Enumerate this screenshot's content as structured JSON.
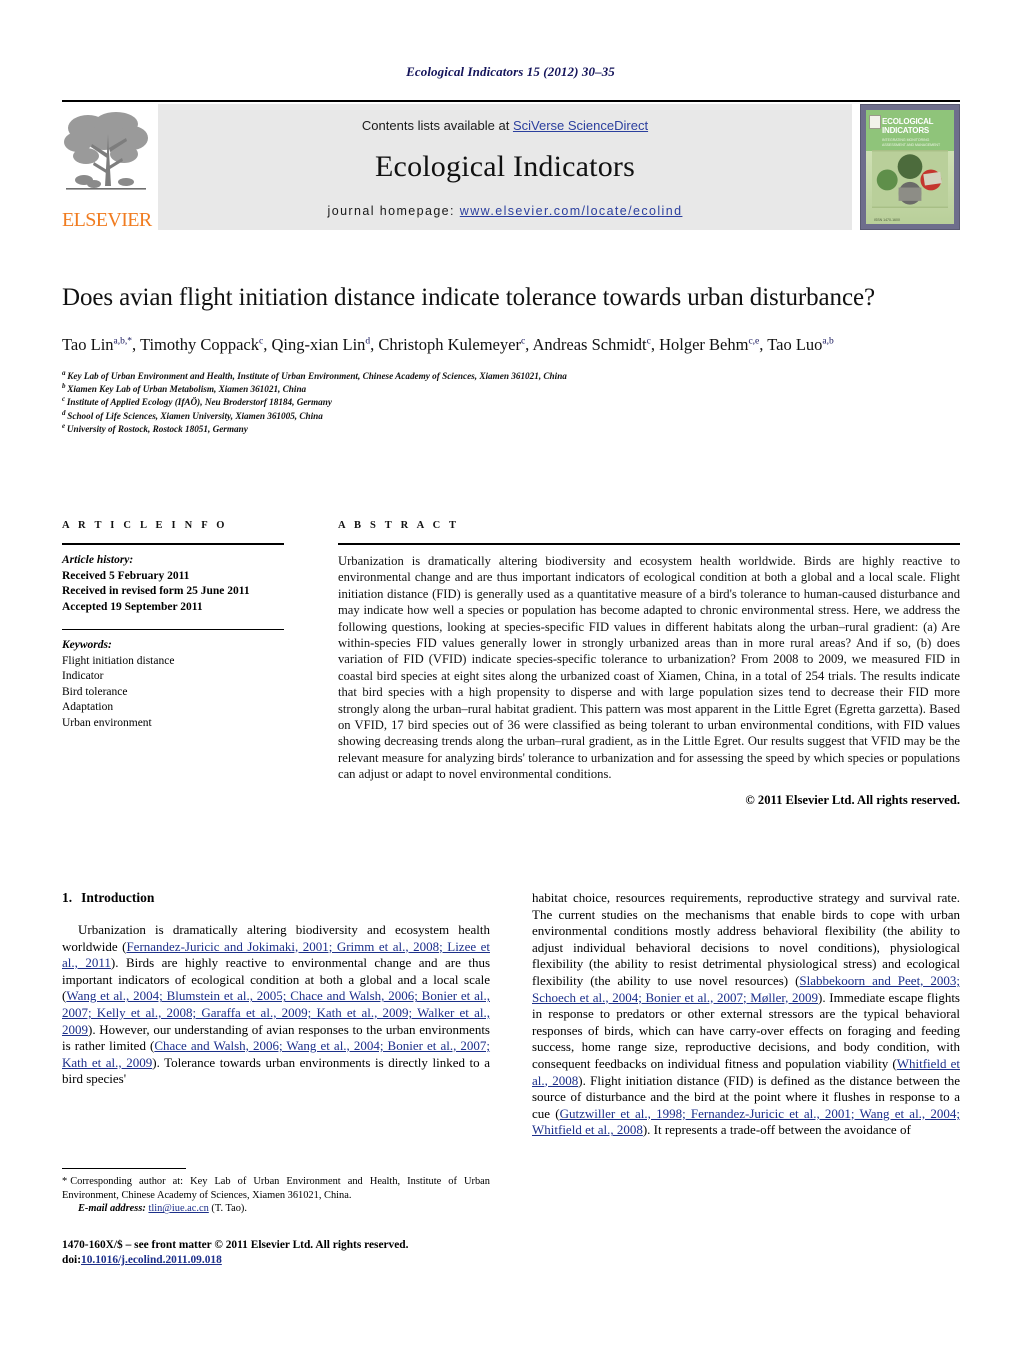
{
  "running_head": "Ecological Indicators 15 (2012) 30–35",
  "masthead": {
    "publisher_name": "ELSEVIER",
    "contents_prefix": "Contents lists available at ",
    "contents_link": "SciVerse ScienceDirect",
    "journal_name": "Ecological Indicators",
    "homepage_prefix": "journal homepage: ",
    "homepage_url": "www.elsevier.com/locate/ecolind",
    "cover": {
      "title_line1": "ECOLOGICAL",
      "title_line2": "INDICATORS",
      "subtitle": "INTEGRATING MONITORING ASSESSMENT AND MANAGEMENT",
      "footer": "ISSN 1470-160X"
    }
  },
  "article": {
    "title": "Does avian flight initiation distance indicate tolerance towards urban disturbance?",
    "authors": [
      {
        "name": "Tao Lin",
        "sup": "a,b,*",
        "sep": ", "
      },
      {
        "name": "Timothy Coppack",
        "sup": "c",
        "sep": ", "
      },
      {
        "name": "Qing-xian Lin",
        "sup": "d",
        "sep": ", "
      },
      {
        "name": "Christoph Kulemeyer",
        "sup": "c",
        "sep": ", "
      },
      {
        "name": "Andreas Schmidt",
        "sup": "c",
        "sep": ", "
      },
      {
        "name": "Holger Behm",
        "sup": "c,e",
        "sep": ", "
      },
      {
        "name": "Tao Luo",
        "sup": "a,b",
        "sep": ""
      }
    ],
    "affiliations": [
      {
        "sup": "a",
        "text": "Key Lab of Urban Environment and Health, Institute of Urban Environment, Chinese Academy of Sciences, Xiamen 361021, China"
      },
      {
        "sup": "b",
        "text": "Xiamen Key Lab of Urban Metabolism, Xiamen 361021, China"
      },
      {
        "sup": "c",
        "text": "Institute of Applied Ecology (IfAÖ), Neu Broderstorf 18184, Germany"
      },
      {
        "sup": "d",
        "text": "School of Life Sciences, Xiamen University, Xiamen 361005, China"
      },
      {
        "sup": "e",
        "text": "University of Rostock, Rostock 18051, Germany"
      }
    ]
  },
  "article_info": {
    "heading": "A R T I C L E   I N F O",
    "history_label": "Article history:",
    "history": [
      "Received 5 February 2011",
      "Received in revised form 25 June 2011",
      "Accepted 19 September 2011"
    ],
    "keywords_label": "Keywords:",
    "keywords": [
      "Flight initiation distance",
      "Indicator",
      "Bird tolerance",
      "Adaptation",
      "Urban environment"
    ]
  },
  "abstract": {
    "heading": "A B S T R A C T",
    "text": "Urbanization is dramatically altering biodiversity and ecosystem health worldwide. Birds are highly reactive to environmental change and are thus important indicators of ecological condition at both a global and a local scale. Flight initiation distance (FID) is generally used as a quantitative measure of a bird's tolerance to human-caused disturbance and may indicate how well a species or population has become adapted to chronic environmental stress. Here, we address the following questions, looking at species-specific FID values in different habitats along the urban–rural gradient: (a) Are within-species FID values generally lower in strongly urbanized areas than in more rural areas? And if so, (b) does variation of FID (VFID) indicate species-specific tolerance to urbanization? From 2008 to 2009, we measured FID in coastal bird species at eight sites along the urbanized coast of Xiamen, China, in a total of 254 trials. The results indicate that bird species with a high propensity to disperse and with large population sizes tend to decrease their FID more strongly along the urban–rural habitat gradient. This pattern was most apparent in the Little Egret (Egretta garzetta). Based on VFID, 17 bird species out of 36 were classified as being tolerant to urban environmental conditions, with FID values showing decreasing trends along the urban–rural gradient, as in the Little Egret. Our results suggest that VFID may be the relevant measure for analyzing birds' tolerance to urbanization and for assessing the speed by which species or populations can adjust or adapt to novel environmental conditions.",
    "copyright": "© 2011 Elsevier Ltd. All rights reserved."
  },
  "body": {
    "section_number": "1.",
    "section_title": "Introduction",
    "left_paragraph_parts": [
      {
        "t": "Urbanization is dramatically altering biodiversity and ecosystem health worldwide (",
        "c": false
      },
      {
        "t": "Fernandez-Juricic and Jokimaki, 2001; Grimm et al., 2008; Lizee et al., 2011",
        "c": true
      },
      {
        "t": "). Birds are highly reactive to environmental change and are thus important indicators of ecological condition at both a global and a local scale (",
        "c": false
      },
      {
        "t": "Wang et al., 2004; Blumstein et al., 2005; Chace and Walsh, 2006; Bonier et al., 2007; Kelly et al., 2008; Garaffa et al., 2009; Kath et al., 2009; Walker et al., 2009",
        "c": true
      },
      {
        "t": "). However, our understanding of avian responses to the urban environments is rather limited (",
        "c": false
      },
      {
        "t": "Chace and Walsh, 2006; Wang et al., 2004; Bonier et al., 2007; Kath et al., 2009",
        "c": true
      },
      {
        "t": "). Tolerance towards urban environments is directly linked to a bird species'",
        "c": false
      }
    ],
    "right_paragraph_parts": [
      {
        "t": "habitat choice, resources requirements, reproductive strategy and survival rate. The current studies on the mechanisms that enable birds to cope with urban environmental conditions mostly address behavioral flexibility (the ability to adjust individual behavioral decisions to novel conditions), physiological flexibility (the ability to resist detrimental physiological stress) and ecological flexibility (the ability to use novel resources) (",
        "c": false
      },
      {
        "t": "Slabbekoorn and Peet, 2003; Schoech et al., 2004; Bonier et al., 2007; Møller, 2009",
        "c": true
      },
      {
        "t": "). Immediate escape flights in response to predators or other external stressors are the typical behavioral responses of birds, which can have carry-over effects on foraging and feeding success, home range size, reproductive decisions, and body condition, with consequent feedbacks on individual fitness and population viability (",
        "c": false
      },
      {
        "t": "Whitfield et al., 2008",
        "c": true
      },
      {
        "t": "). Flight initiation distance (FID) is defined as the distance between the source of disturbance and the bird at the point where it flushes in response to a cue (",
        "c": false
      },
      {
        "t": "Gutzwiller et al., 1998; Fernandez-Juricic et al., 2001; Wang et al., 2004; Whitfield et al., 2008",
        "c": true
      },
      {
        "t": "). It represents a trade-off between the avoidance of",
        "c": false
      }
    ]
  },
  "footnote": {
    "star": "*",
    "corresponding": "Corresponding author at: Key Lab of Urban Environment and Health, Institute of Urban Environment, Chinese Academy of Sciences, Xiamen 361021, China.",
    "email_label": "E-mail address:",
    "email": "tlin@iue.ac.cn",
    "email_suffix": "(T. Tao)."
  },
  "imprint": {
    "line1": "1470-160X/$ – see front matter © 2011 Elsevier Ltd. All rights reserved.",
    "doi_label": "doi:",
    "doi": "10.1016/j.ecolind.2011.09.018"
  },
  "colors": {
    "link_blue": "#2b3f9e",
    "citation_blue": "#1c2f8a",
    "elsevier_orange": "#f07c20",
    "band_grey": "#e8e8e8",
    "running_head_navy": "#14145a"
  }
}
